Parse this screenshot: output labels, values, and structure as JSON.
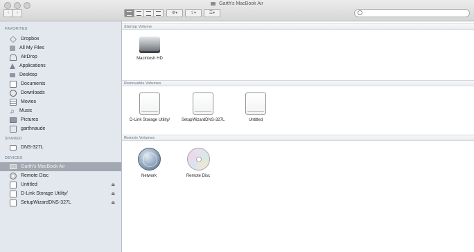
{
  "window": {
    "title": "Garth's MacBook Air"
  },
  "toolbar": {
    "back_glyph": "‹",
    "forward_glyph": "›",
    "search": {
      "value": "",
      "placeholder": ""
    }
  },
  "sidebar": {
    "favorites_header": "FAVORITES",
    "favorites": [
      {
        "label": "Dropbox",
        "icon": "dropbox-icon"
      },
      {
        "label": "All My Files",
        "icon": "all-files-icon"
      },
      {
        "label": "AirDrop",
        "icon": "airdrop-icon"
      },
      {
        "label": "Applications",
        "icon": "applications-icon"
      },
      {
        "label": "Desktop",
        "icon": "desktop-icon"
      },
      {
        "label": "Documents",
        "icon": "documents-icon"
      },
      {
        "label": "Downloads",
        "icon": "downloads-icon"
      },
      {
        "label": "Movies",
        "icon": "movies-icon"
      },
      {
        "label": "Music",
        "icon": "music-icon"
      },
      {
        "label": "Pictures",
        "icon": "pictures-icon"
      },
      {
        "label": "garthnaude",
        "icon": "home-folder-icon"
      }
    ],
    "shared_header": "SHARED",
    "shared": [
      {
        "label": "DNS-327L",
        "icon": "server-icon"
      }
    ],
    "devices_header": "DEVICES",
    "devices": [
      {
        "label": "Garth's MacBook Air",
        "icon": "laptop-icon",
        "selected": true
      },
      {
        "label": "Remote Disc",
        "icon": "remote-disc-icon"
      },
      {
        "label": "Untitled",
        "icon": "drive-icon",
        "eject": "⏏"
      },
      {
        "label": "D-Link Storage Utility/",
        "icon": "drive-icon",
        "eject": "⏏"
      },
      {
        "label": "SetupWizardDNS-327L",
        "icon": "drive-icon",
        "eject": "⏏"
      }
    ]
  },
  "main": {
    "startup_header": "Startup Volume",
    "startup_items": [
      {
        "label": "Macintosh HD",
        "icon": "hard-disk-icon"
      }
    ],
    "removable_header": "Removable Volumes",
    "removable_items": [
      {
        "label": "D-Link Storage Utility/",
        "icon": "external-drive-icon"
      },
      {
        "label": "SetupWizardDNS-327L",
        "icon": "external-drive-icon"
      },
      {
        "label": "Untitled",
        "icon": "external-drive-icon"
      }
    ],
    "remote_header": "Remote Volumes",
    "remote_items": [
      {
        "label": "Network",
        "icon": "network-globe-icon"
      },
      {
        "label": "Remote Disc",
        "icon": "cd-disc-icon"
      }
    ]
  }
}
